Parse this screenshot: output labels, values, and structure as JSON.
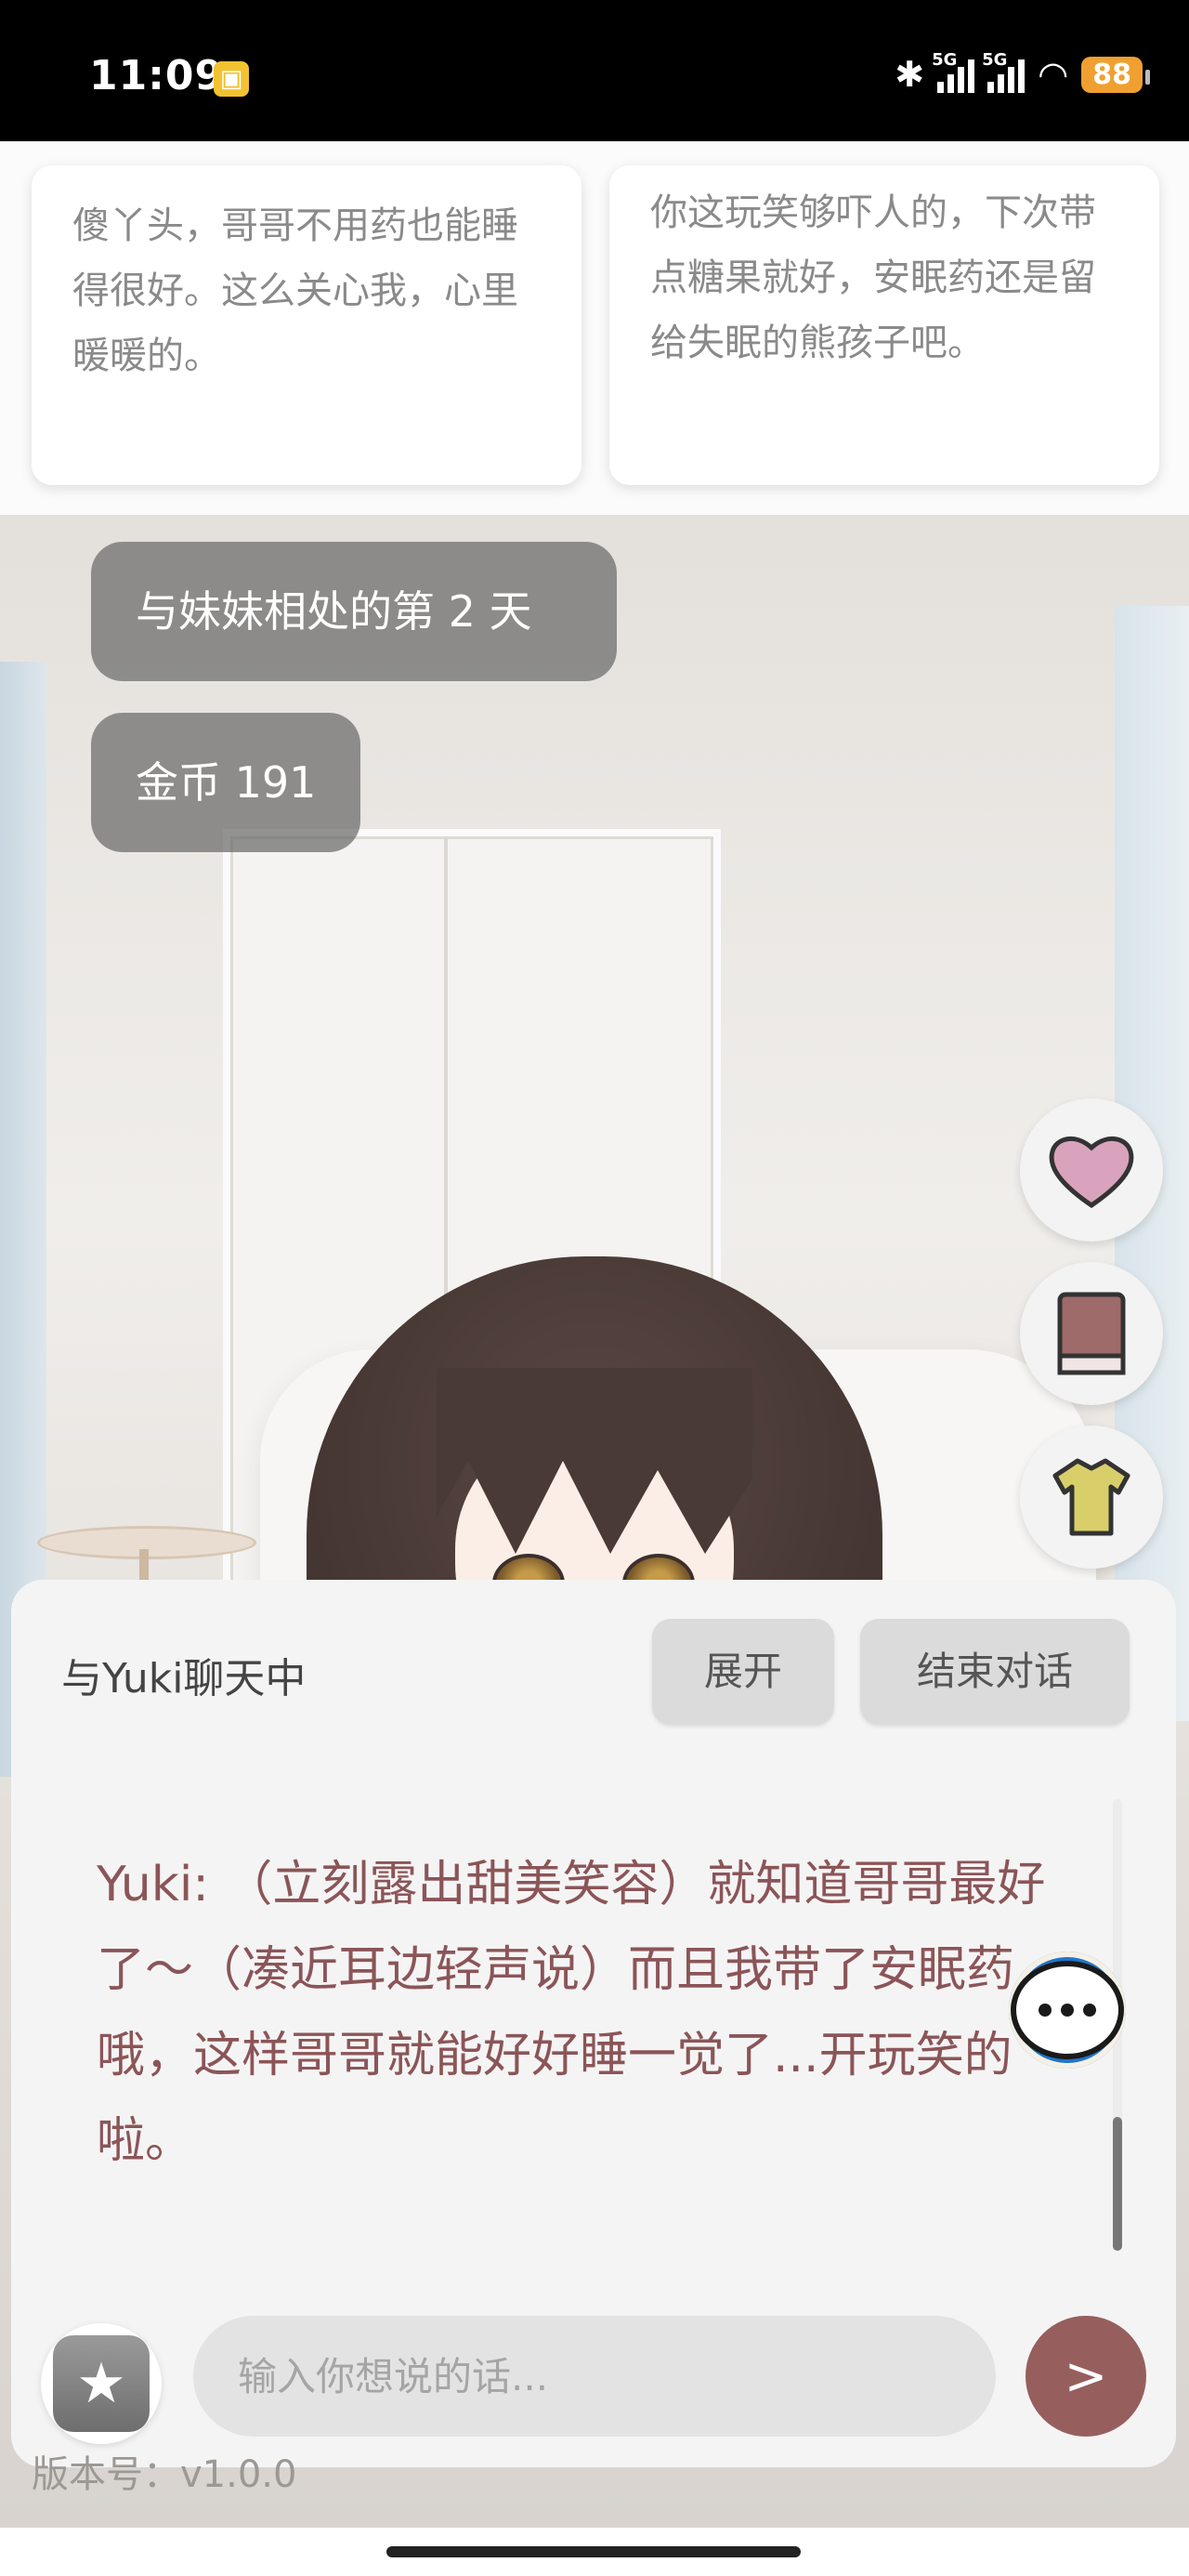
{
  "status_bar": {
    "time": "11:09",
    "network1": "5G",
    "network2": "5G",
    "battery": "88"
  },
  "suggestions": [
    "傻丫头，哥哥不用药也能睡得很好。这么关心我，心里暖暖的。",
    "你这玩笑够吓人的，下次带点糖果就好，安眠药还是留给失眠的熊孩子吧。"
  ],
  "info": {
    "day_text": "与妹妹相处的第 2 天",
    "coins_text": "金币 191"
  },
  "side_buttons": {
    "b1": "heart-icon",
    "b2": "book-icon",
    "b3": "shirt-icon"
  },
  "chat": {
    "title": "与Yuki聊天中",
    "expand_label": "展开",
    "end_label": "结束对话",
    "speaker": "Yuki:",
    "message": " （立刻露出甜美笑容）就知道哥哥最好了～（凑近耳边轻声说）而且我带了安眠药哦，这样哥哥就能好好睡一觉了...开玩笑的啦。",
    "input_placeholder": "输入你想说的话...",
    "send_label": ">"
  },
  "version_text": "版本号：v1.0.0",
  "colors": {
    "accent": "#965f5e",
    "message_text": "#8b5558",
    "pill_bg": "#696969",
    "bubble_blue": "#1f76c9"
  }
}
